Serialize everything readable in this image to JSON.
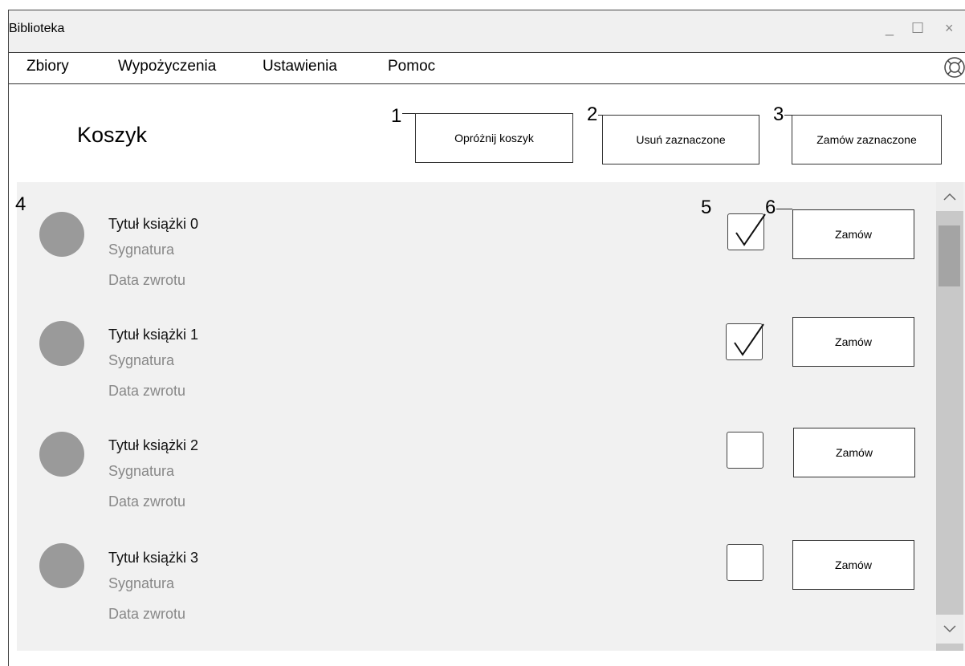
{
  "window": {
    "title": "Biblioteka",
    "minimize_glyph": "_",
    "maximize_glyph": "☐",
    "close_glyph": "×"
  },
  "menu": [
    "Zbiory",
    "Wypożyczenia",
    "Ustawienia",
    "Pomoc"
  ],
  "help_icon": "lifebuoy-icon",
  "page_title": "Koszyk",
  "annotations": [
    "1",
    "2",
    "3",
    "4",
    "5",
    "6"
  ],
  "toolbar": {
    "empty_cart": "Opróżnij koszyk",
    "remove_selected": "Usuń zaznaczone",
    "order_selected": "Zamów zaznaczone"
  },
  "items": [
    {
      "title": "Tytuł książki 0",
      "signature": "Sygnatura",
      "return_date": "Data zwrotu",
      "checked": true,
      "order_label": "Zamów"
    },
    {
      "title": "Tytuł książki 1",
      "signature": "Sygnatura",
      "return_date": "Data zwrotu",
      "checked": true,
      "order_label": "Zamów"
    },
    {
      "title": "Tytuł książki 2",
      "signature": "Sygnatura",
      "return_date": "Data zwrotu",
      "checked": false,
      "order_label": "Zamów"
    },
    {
      "title": "Tytuł książki 3",
      "signature": "Sygnatura",
      "return_date": "Data zwrotu",
      "checked": false,
      "order_label": "Zamów"
    }
  ],
  "scrollbar": {
    "up_icon": "chevron-up-icon",
    "down_icon": "chevron-down-icon",
    "position_fraction": 0.0
  },
  "colors": {
    "avatar": "#9a9a9a",
    "list_bg": "#f1f1f1",
    "scroll_track": "#c8c8c8",
    "scroll_thumb": "#a4a4a4"
  }
}
